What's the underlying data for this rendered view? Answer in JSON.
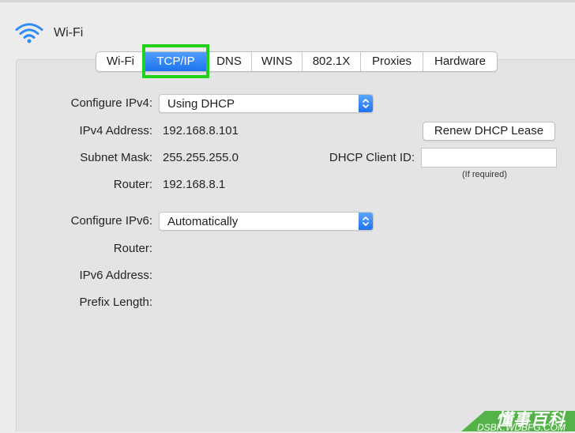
{
  "header": {
    "title": "Wi-Fi",
    "icon": "wifi-icon"
  },
  "tabs": [
    {
      "label": "Wi-Fi"
    },
    {
      "label": "TCP/IP",
      "active": true
    },
    {
      "label": "DNS"
    },
    {
      "label": "WINS"
    },
    {
      "label": "802.1X"
    },
    {
      "label": "Proxies"
    },
    {
      "label": "Hardware"
    }
  ],
  "ipv4": {
    "configure_label": "Configure IPv4:",
    "configure_value": "Using DHCP",
    "address_label": "IPv4 Address:",
    "address_value": "192.168.8.101",
    "subnet_label": "Subnet Mask:",
    "subnet_value": "255.255.255.0",
    "router_label": "Router:",
    "router_value": "192.168.8.1"
  },
  "dhcp": {
    "renew_button": "Renew DHCP Lease",
    "client_id_label": "DHCP Client ID:",
    "client_id_value": "",
    "client_id_hint": "(If required)"
  },
  "ipv6": {
    "configure_label": "Configure IPv6:",
    "configure_value": "Automatically",
    "router_label": "Router:",
    "address_label": "IPv6 Address:",
    "prefix_label": "Prefix Length:"
  },
  "watermark": {
    "text": "懂事百科",
    "subtext": "DSBK.WDBFG.COM"
  },
  "colors": {
    "highlight": "#22d11b",
    "active_tab": "#1e74f0",
    "watermark": "#46af3c"
  }
}
